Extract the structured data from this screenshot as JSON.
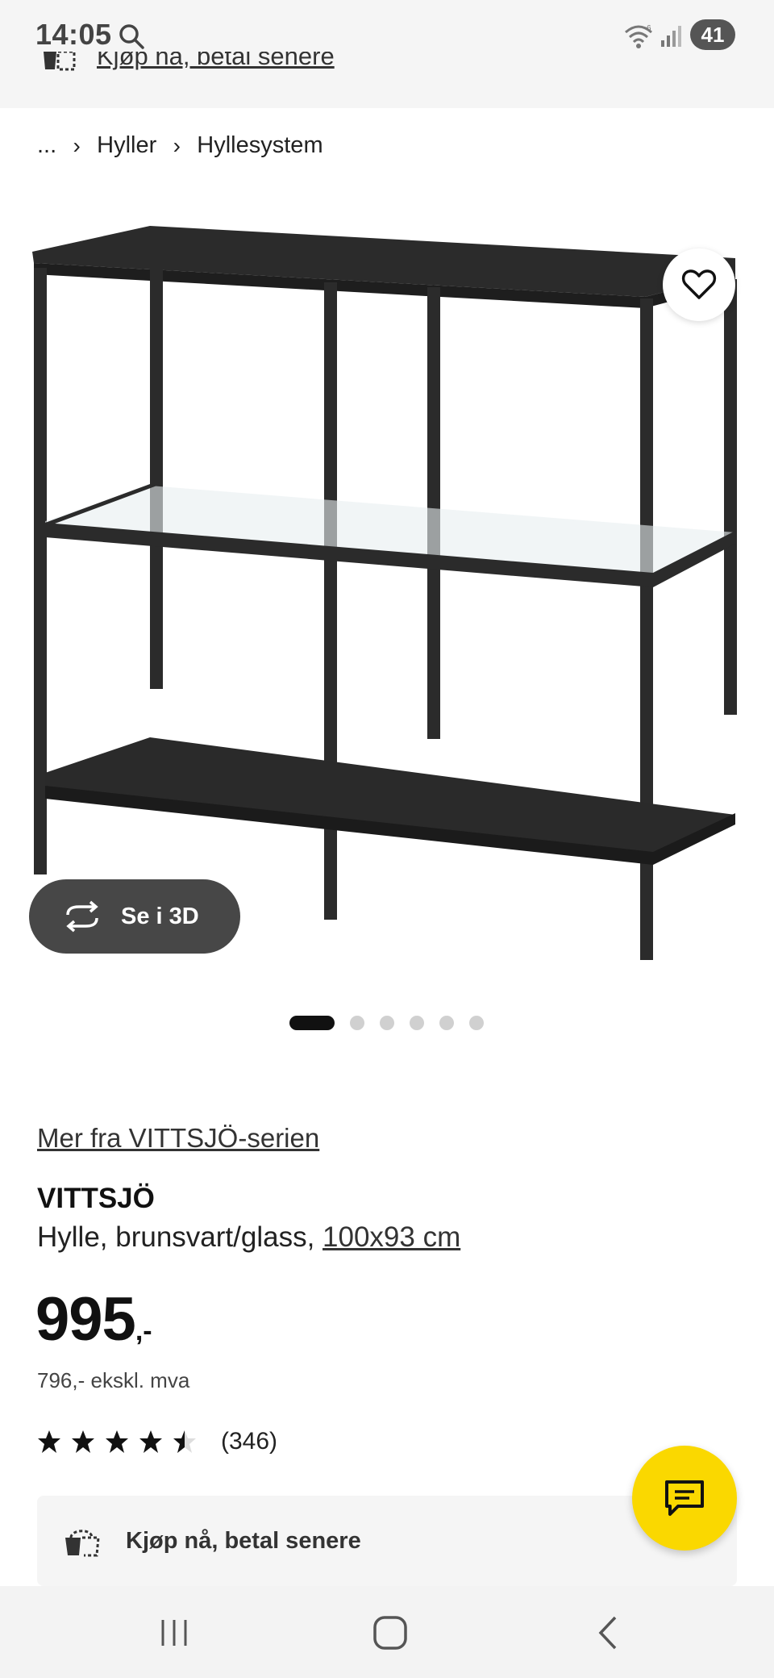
{
  "status_bar": {
    "time": "14:05",
    "battery_level": "41",
    "icons": [
      "search-icon",
      "wifi-icon",
      "signal-icon",
      "battery-icon"
    ]
  },
  "sticky_header": {
    "bnpl_label": "Kjøp nå, betal senere"
  },
  "breadcrumb": {
    "items": [
      "...",
      "Hyller",
      "Hyllesystem"
    ]
  },
  "gallery": {
    "view_3d_label": "Se i 3D",
    "image_count": 6,
    "active_index": 0
  },
  "product": {
    "series_link": "Mer fra VITTSJÖ-serien",
    "name": "VITTSJÖ",
    "description_prefix": "Hylle, brunsvart/glass, ",
    "size": "100x93 cm",
    "price_amount": "995",
    "price_suffix": ",-",
    "price_ex_vat": "796,- ekskl. mva",
    "rating": 4.5,
    "rating_max": 5,
    "review_count": "(346)"
  },
  "bnpl_card": {
    "label": "Kjøp nå, betal senere"
  },
  "colors": {
    "accent_yellow": "#fad800",
    "dark_button": "#474747",
    "status_bg": "#f5f5f5"
  }
}
